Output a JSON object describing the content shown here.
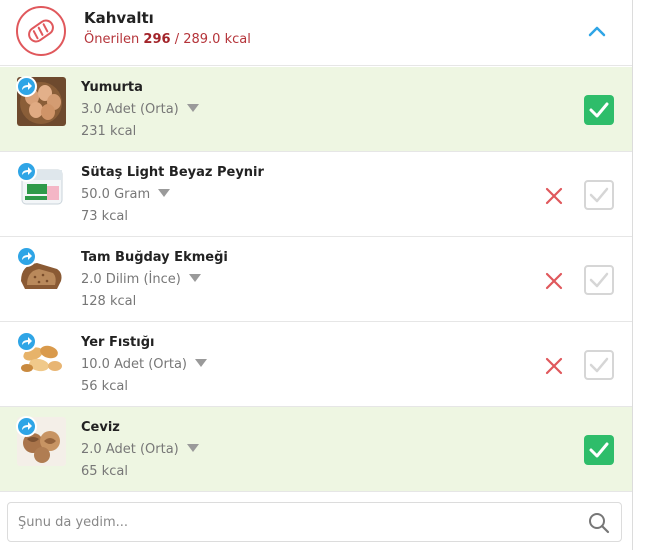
{
  "meal": {
    "title": "Kahvaltı",
    "recommended_label": "Önerilen",
    "current_kcal": "296",
    "target": "/ 289.0 kcal",
    "icon": "bread-icon",
    "collapse_icon": "chevron-up-icon"
  },
  "foods": [
    {
      "name": "Yumurta",
      "portion": "3.0 Adet (Orta)",
      "kcal": "231 kcal",
      "checked": true,
      "image": "eggs"
    },
    {
      "name": "Sütaş Light Beyaz Peynir",
      "portion": "50.0 Gram",
      "kcal": "73 kcal",
      "checked": false,
      "image": "cheese-package"
    },
    {
      "name": "Tam Buğday Ekmeği",
      "portion": "2.0 Dilim (İnce)",
      "kcal": "128 kcal",
      "checked": false,
      "image": "whole-wheat-bread"
    },
    {
      "name": "Yer Fıstığı",
      "portion": "10.0 Adet (Orta)",
      "kcal": "56 kcal",
      "checked": false,
      "image": "peanuts"
    },
    {
      "name": "Ceviz",
      "portion": "2.0 Adet (Orta)",
      "kcal": "65 kcal",
      "checked": true,
      "image": "walnuts"
    }
  ],
  "search": {
    "placeholder": "Şunu da yedim..."
  },
  "colors": {
    "accent_red": "#e0585c",
    "check_green": "#2ebd6a",
    "checked_row_bg": "#eef6e2",
    "swap_blue": "#2fa5e6",
    "chevron_blue": "#2fa5e6"
  }
}
